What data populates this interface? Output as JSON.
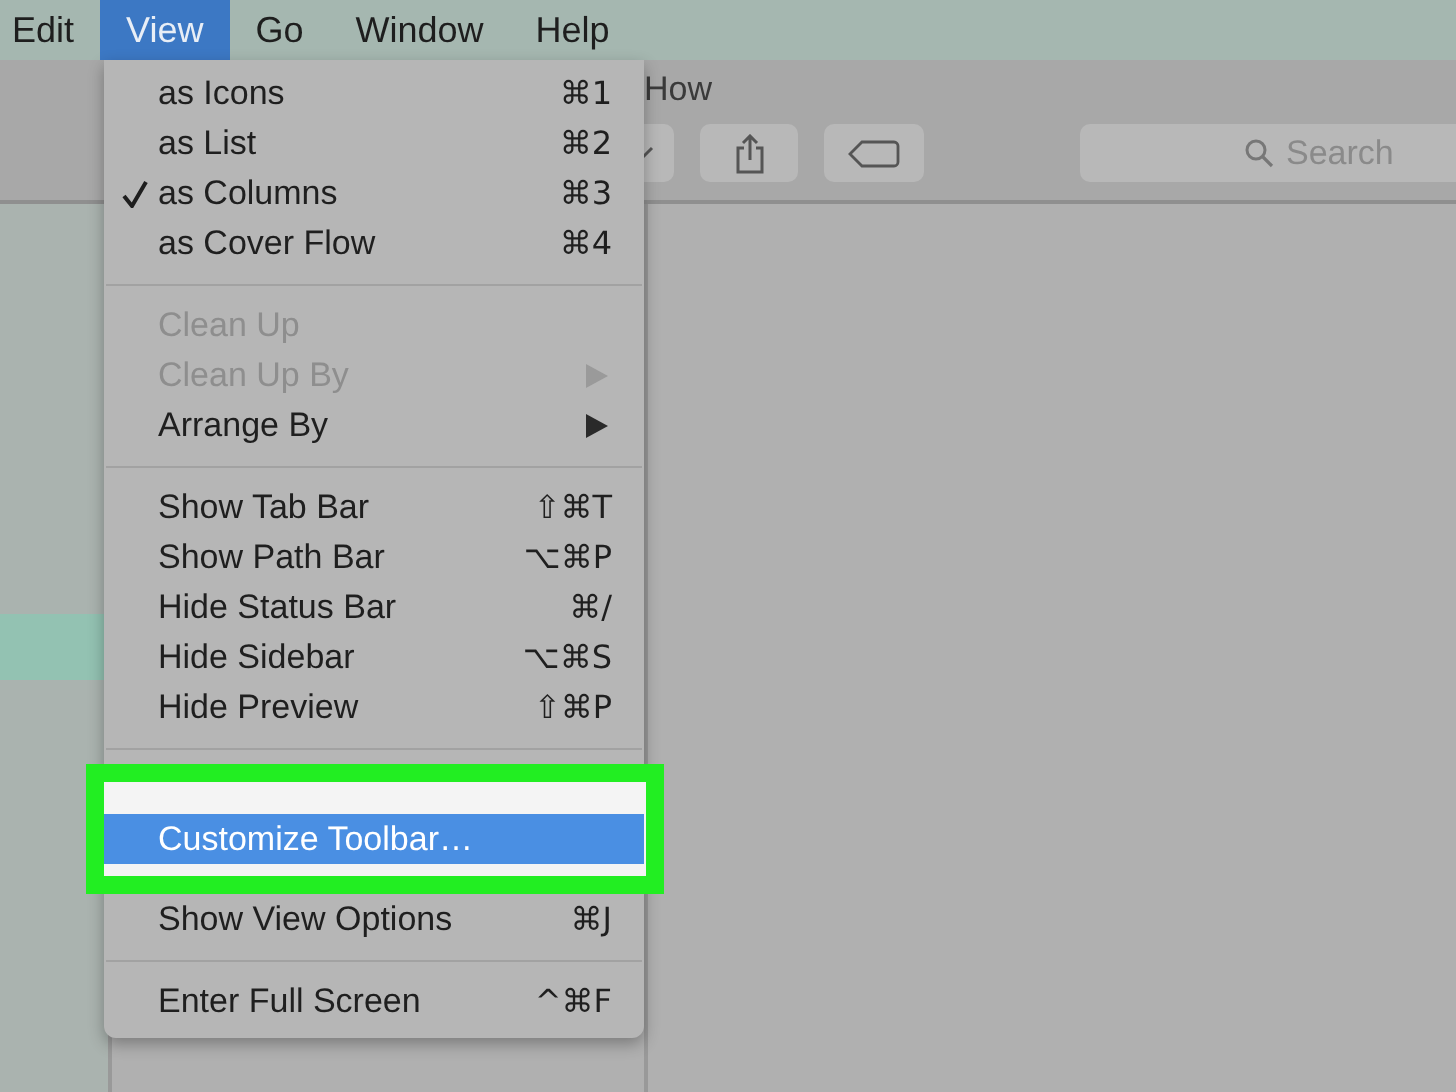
{
  "menu_bar": {
    "items": [
      {
        "label": "Edit",
        "selected": false
      },
      {
        "label": "View",
        "selected": true
      },
      {
        "label": "Go",
        "selected": false
      },
      {
        "label": "Window",
        "selected": false
      },
      {
        "label": "Help",
        "selected": false
      }
    ]
  },
  "window": {
    "title": "How",
    "search": {
      "placeholder": "Search"
    }
  },
  "sidebar": {
    "rows": [
      {
        "selected": true
      }
    ]
  },
  "view_menu": {
    "highlight_frame": true,
    "items": [
      {
        "kind": "item",
        "label": "as Icons",
        "shortcut": "⌘1",
        "checked": false,
        "disabled": false,
        "submenu": false,
        "selected": false
      },
      {
        "kind": "item",
        "label": "as List",
        "shortcut": "⌘2",
        "checked": false,
        "disabled": false,
        "submenu": false,
        "selected": false
      },
      {
        "kind": "item",
        "label": "as Columns",
        "shortcut": "⌘3",
        "checked": true,
        "disabled": false,
        "submenu": false,
        "selected": false
      },
      {
        "kind": "item",
        "label": "as Cover Flow",
        "shortcut": "⌘4",
        "checked": false,
        "disabled": false,
        "submenu": false,
        "selected": false
      },
      {
        "kind": "separator"
      },
      {
        "kind": "item",
        "label": "Clean Up",
        "checked": false,
        "disabled": true,
        "submenu": false,
        "selected": false
      },
      {
        "kind": "item",
        "label": "Clean Up By",
        "checked": false,
        "disabled": true,
        "submenu": true,
        "selected": false
      },
      {
        "kind": "item",
        "label": "Arrange By",
        "checked": false,
        "disabled": false,
        "submenu": true,
        "selected": false
      },
      {
        "kind": "separator"
      },
      {
        "kind": "item",
        "label": "Show Tab Bar",
        "shortcut": "⇧⌘T",
        "checked": false,
        "disabled": false,
        "submenu": false,
        "selected": false
      },
      {
        "kind": "item",
        "label": "Show Path Bar",
        "shortcut": "⌥⌘P",
        "checked": false,
        "disabled": false,
        "submenu": false,
        "selected": false
      },
      {
        "kind": "item",
        "label": "Hide Status Bar",
        "shortcut": "⌘/",
        "checked": false,
        "disabled": false,
        "submenu": false,
        "selected": false
      },
      {
        "kind": "item",
        "label": "Hide Sidebar",
        "shortcut": "⌥⌘S",
        "checked": false,
        "disabled": false,
        "submenu": false,
        "selected": false
      },
      {
        "kind": "item",
        "label": "Hide Preview",
        "shortcut": "⇧⌘P",
        "checked": false,
        "disabled": false,
        "submenu": false,
        "selected": false
      },
      {
        "kind": "separator"
      },
      {
        "kind": "item",
        "label": "Customize Toolbar…",
        "checked": false,
        "disabled": false,
        "submenu": false,
        "selected": true
      },
      {
        "kind": "item",
        "label": "Show View Options",
        "shortcut": "⌘J",
        "checked": false,
        "disabled": false,
        "submenu": false,
        "selected": false
      },
      {
        "kind": "separator"
      },
      {
        "kind": "item",
        "label": "Enter Full Screen",
        "shortcut": "^⌘F",
        "checked": false,
        "disabled": false,
        "submenu": false,
        "selected": false
      }
    ]
  }
}
